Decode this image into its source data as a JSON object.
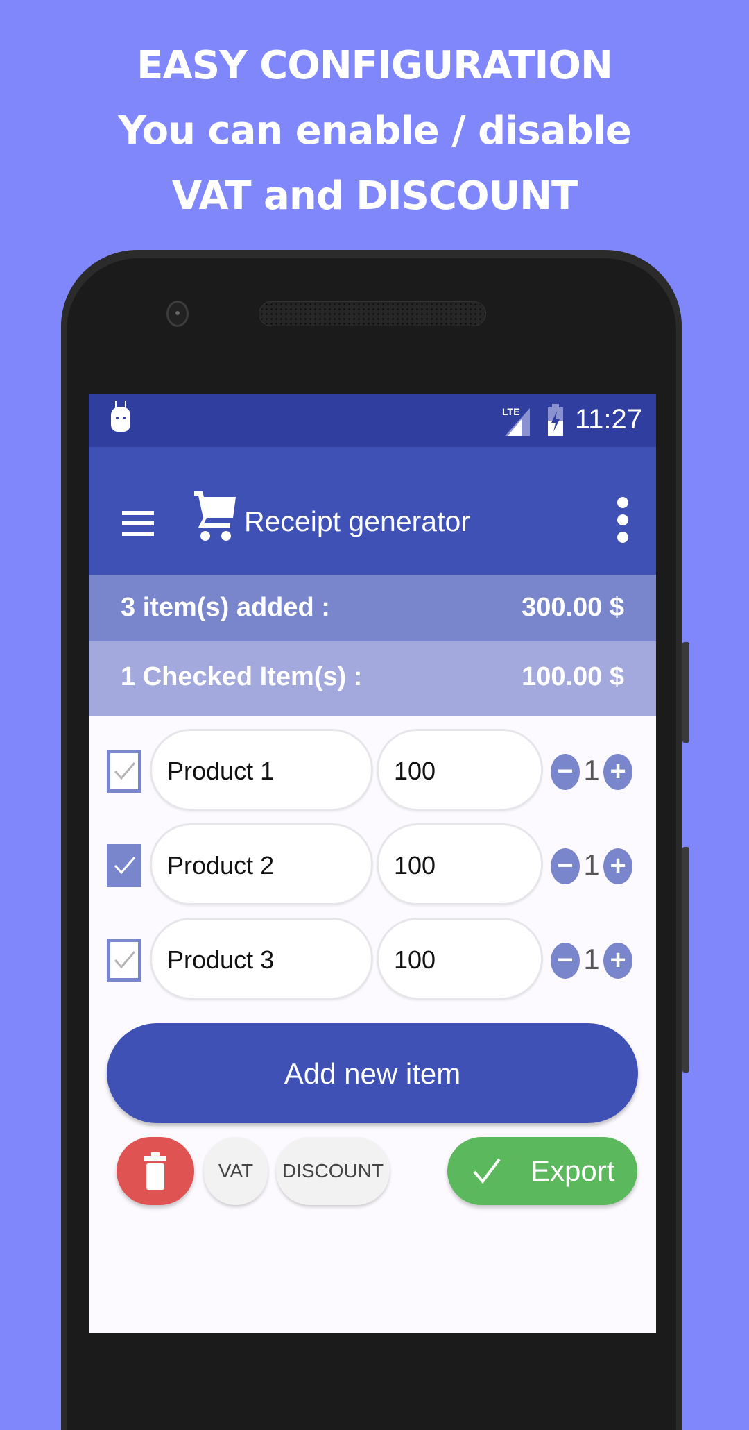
{
  "promo": {
    "line1": "EASY CONFIGURATION",
    "line2": "You can enable / disable",
    "line3": "VAT and DISCOUNT",
    "background_color": "#7f87fb"
  },
  "status_bar": {
    "time": "11:27",
    "network": "LTE",
    "icons": [
      "android-notification-icon",
      "lte-signal-icon",
      "battery-charging-icon"
    ]
  },
  "app_bar": {
    "title": "Receipt generator",
    "icons": [
      "menu-icon",
      "shopping-cart-icon",
      "overflow-menu-icon"
    ],
    "color": "#3f51b5"
  },
  "summary": {
    "added_label": "3 item(s) added :",
    "added_total": "300.00 $",
    "checked_label": "1 Checked Item(s) :",
    "checked_total": "100.00 $"
  },
  "items": [
    {
      "name": "Product 1",
      "price": "100",
      "quantity": "1",
      "checked": false
    },
    {
      "name": "Product 2",
      "price": "100",
      "quantity": "1",
      "checked": true
    },
    {
      "name": "Product 3",
      "price": "100",
      "quantity": "1",
      "checked": false
    }
  ],
  "controls": {
    "minus": "−",
    "plus": "+"
  },
  "actions": {
    "add_item_label": "Add new item",
    "vat_label": "VAT",
    "discount_label": "DISCOUNT",
    "export_label": "Export",
    "delete_color": "#e05353",
    "export_color": "#5cb85c"
  }
}
